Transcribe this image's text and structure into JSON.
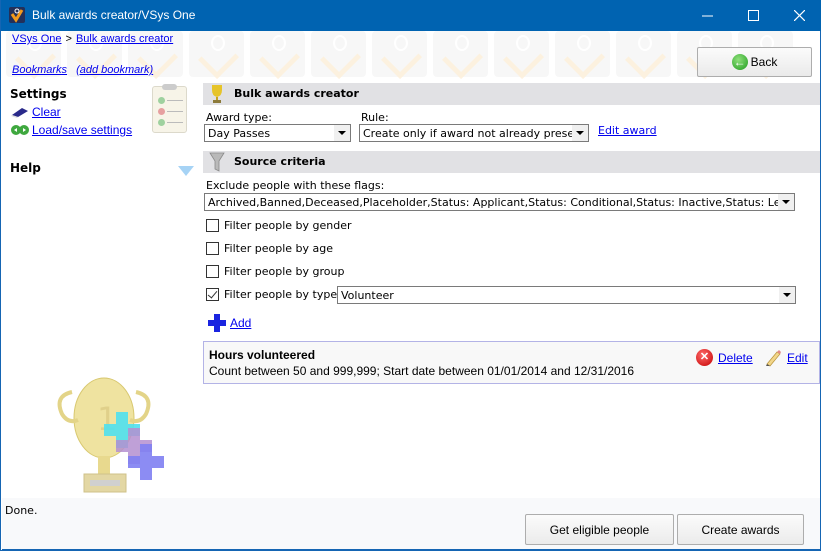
{
  "window": {
    "title": "Bulk awards creator/VSys One",
    "controls": {
      "minimize": "—",
      "maximize": "☐",
      "close": "✕"
    }
  },
  "banner": {
    "breadcrumb": [
      {
        "label": "VSys One"
      },
      {
        "separator": ">"
      },
      {
        "label": "Bulk awards creator"
      }
    ],
    "bookmarks_label": "Bookmarks",
    "add_bookmark_label": "(add bookmark)",
    "back_button": {
      "label": "Back",
      "icon": "arrow-left-circle-icon"
    }
  },
  "sidebar": {
    "settings_heading": "Settings",
    "clear_label": "Clear",
    "load_save_label": "Load/save settings",
    "help_heading": "Help"
  },
  "main": {
    "section_title": "Bulk awards creator",
    "award_type": {
      "label": "Award type:",
      "value": "Day Passes"
    },
    "rule": {
      "label": "Rule:",
      "value": "Create only if award not already present"
    },
    "edit_award_label": "Edit award",
    "source_section_title": "Source criteria",
    "exclude_flags": {
      "label": "Exclude people with these flags:",
      "value": "Archived,Banned,Deceased,Placeholder,Status: Applicant,Status: Conditional,Status: Inactive,Status: Leave of absen"
    },
    "filters": [
      {
        "label": "Filter people by gender",
        "checked": false
      },
      {
        "label": "Filter people by age",
        "checked": false
      },
      {
        "label": "Filter people by group",
        "checked": false
      },
      {
        "label": "Filter people by type",
        "checked": true,
        "value": "Volunteer"
      }
    ],
    "add_label": "Add",
    "criteria": {
      "title": "Hours volunteered",
      "description": "Count between 50 and 999,999; Start date between 01/01/2014 and 12/31/2016",
      "delete_label": "Delete",
      "edit_label": "Edit"
    }
  },
  "footer": {
    "status": "Done.",
    "get_eligible_label": "Get eligible people",
    "create_awards_label": "Create awards"
  },
  "colors": {
    "titlebar": "#0063b1",
    "section_bar": "#e1e1e4",
    "link": "#0000ee",
    "criteria_border": "#b3b3e6"
  }
}
